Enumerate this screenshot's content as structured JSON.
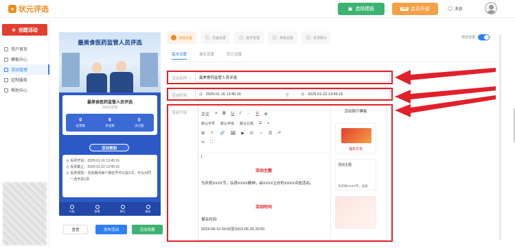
{
  "app": {
    "title": "状元评选"
  },
  "header": {
    "template_btn": "选择模板",
    "vip_badge": "VIP",
    "vip_btn": "会员升级",
    "message": "消息"
  },
  "sidebar": {
    "create_btn": "创建活动",
    "items": [
      {
        "label": "用户首页",
        "active": false
      },
      {
        "label": "模板中心",
        "active": false
      },
      {
        "label": "活动管理",
        "active": true
      },
      {
        "label": "定制服务",
        "active": false
      },
      {
        "label": "帮助中心",
        "active": false
      }
    ]
  },
  "preview": {
    "banner_title": "最美食医药监管人员评选",
    "card_title": "最美食医药监管人员评选",
    "card_status": "活动已结束",
    "stats": [
      {
        "num": "0",
        "label": "投票数"
      },
      {
        "num": "6",
        "label": "参选数"
      },
      {
        "num": "0",
        "label": "访问量"
      }
    ],
    "rule_btn": "活动规则",
    "info": [
      "投票开始：2025-01-16 13:45:16",
      "投票截止：2025-01-22 13:45:16",
      "投票规则：活动期间每个微信号可以投1次，可以对同一选手投1票"
    ],
    "tabs": [
      "介绍",
      "投票",
      "排行",
      "报名"
    ]
  },
  "actions": {
    "reset": "重置",
    "publish": "发布活动",
    "generate": "活动海报"
  },
  "steps": [
    {
      "label": "活动设置",
      "active": true
    },
    {
      "label": "页面设置",
      "active": false
    },
    {
      "label": "选手管理",
      "active": false
    },
    {
      "label": "高级设置",
      "active": false
    },
    {
      "label": "投票统计",
      "active": false
    }
  ],
  "preview_toggle": {
    "label": "预览效果",
    "on": true
  },
  "subtabs": [
    "基本设置",
    "报名设置",
    "其它设置"
  ],
  "form": {
    "name_label": "活动名称",
    "name_value": "最美食药监管人员评选",
    "time_label": "活动时间",
    "start_time": "2025-01-16 13:45:16",
    "time_sep": "至",
    "end_time": "2025-01-22 13:45:16",
    "intro_label": "活动介绍"
  },
  "editor": {
    "toolbar_row1": [
      "正文",
      "❝",
      "B",
      "U",
      "I",
      "···",
      "A",
      "⊕"
    ],
    "toolbar_row2": [
      "默认字号",
      "默认字体",
      "默认行高",
      "☰",
      "≡"
    ],
    "toolbar_row3": [
      "⊞",
      "☺",
      "🔗",
      "🖼",
      "▶",
      "⊡",
      "↔",
      "☰",
      "↶"
    ],
    "toolbar_row4": [
      "↷",
      "⛶"
    ],
    "heading1": "活动主题",
    "paragraph1": "为庆祝XXXX节，弘扬XXXX精神，由XXXX主办的XXXX评选活动。",
    "heading2": "活动时间",
    "paragraph2": "报名时间:",
    "paragraph3": "2019-06-10 00:00至2019-06-20 20:00"
  },
  "templates": {
    "title": "活动简介模板",
    "item1_text": "福年华吉",
    "item2_title": "活动主题",
    "item2_text": "为庆祝XXXX节，弘扬"
  },
  "colors": {
    "accent": "#2f7ff7",
    "brand": "#f08a1c",
    "highlight": "#e0202a",
    "phone_bg": "#2d59c7"
  }
}
